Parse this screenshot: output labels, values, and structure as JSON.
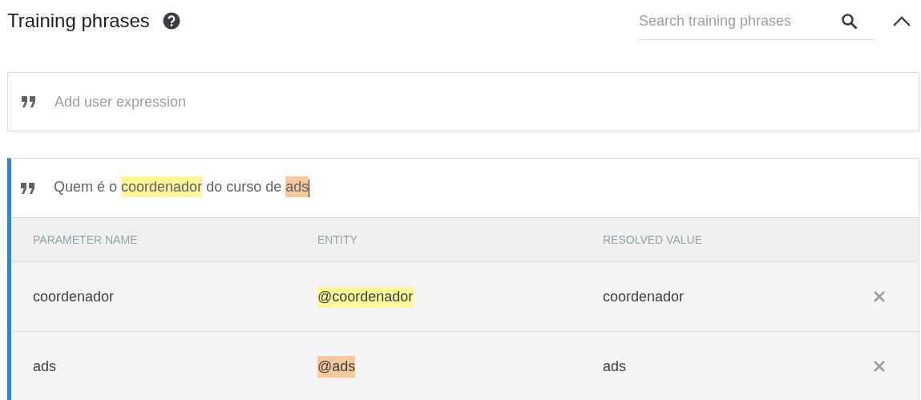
{
  "section": {
    "title": "Training phrases",
    "expanded": true
  },
  "search": {
    "placeholder": "Search training phrases"
  },
  "add_expression": {
    "placeholder": "Add user expression"
  },
  "phrases": [
    {
      "selected": true,
      "segments": [
        {
          "text": "Quem é o "
        },
        {
          "text": "coordenador",
          "color": "#fff899"
        },
        {
          "text": " do curso de "
        },
        {
          "text": "ads",
          "color": "#f9c89d"
        }
      ],
      "table": {
        "columns": [
          "PARAMETER NAME",
          "ENTITY",
          "RESOLVED VALUE"
        ],
        "rows": [
          {
            "parameter": "coordenador",
            "entity": "@coordenador",
            "color": "#fff899",
            "value": "coordenador"
          },
          {
            "parameter": "ads",
            "entity": "@ads",
            "color": "#f9c89d",
            "value": "ads"
          }
        ]
      }
    }
  ]
}
